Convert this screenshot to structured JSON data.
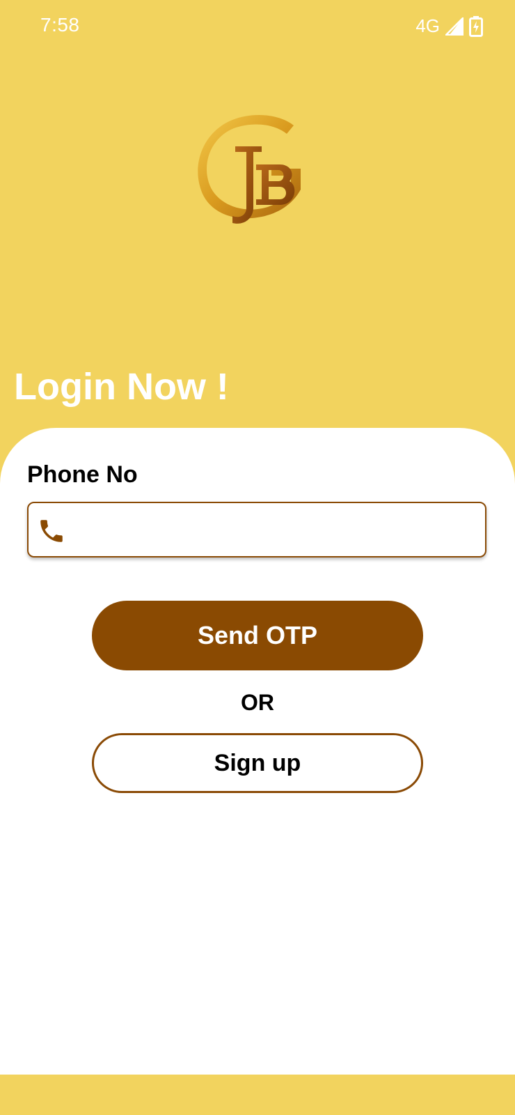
{
  "status_bar": {
    "time": "7:58",
    "network": "4G",
    "icons": [
      "signal-icon",
      "battery-charging-icon"
    ]
  },
  "logo": {
    "name": "jbg-monogram-logo"
  },
  "login": {
    "title": "Login Now !",
    "phone_label": "Phone No",
    "phone_value": "",
    "phone_icon": "phone-icon",
    "send_otp_label": "Send OTP",
    "or_label": "OR",
    "signup_label": "Sign up"
  },
  "colors": {
    "background": "#F2D35E",
    "primary_brown": "#8A4A02",
    "card": "#FFFFFF"
  }
}
